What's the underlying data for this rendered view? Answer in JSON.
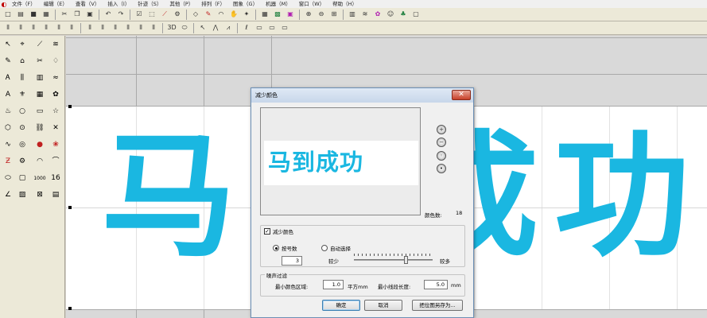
{
  "menu": {
    "items": [
      "文件（F）",
      "编辑（E）",
      "查看（V）",
      "插入（I）",
      "针迹（S）",
      "其他（P）",
      "排列（F）",
      "图象（G）",
      "机器（M）",
      "窗口（W）",
      "帮助（H）"
    ]
  },
  "toolbar1": {
    "icons": [
      "new-file-icon",
      "open-folder-icon",
      "save-icon",
      "print-icon",
      "cut-icon",
      "copy-icon",
      "paste-icon",
      "undo-icon",
      "redo-icon",
      "rect-select-icon",
      "node-edit-icon",
      "needle-icon",
      "tool-icon",
      "shape-icon",
      "pen-icon",
      "curve-icon",
      "hand-icon",
      "wand-icon",
      "grid-icon",
      "picture-icon",
      "color-icon",
      "zoom-in-icon",
      "zoom-out-icon",
      "zoom-all-icon",
      "fill-pattern-icon",
      "stitch-icon",
      "flower-icon",
      "people-icon",
      "tree-icon",
      "frame-icon"
    ],
    "glyphs": [
      "□",
      "▤",
      "■",
      "▦",
      "✂",
      "❐",
      "▣",
      "↶",
      "↷",
      "☑",
      "⬚",
      "⟋",
      "⚙",
      "◇",
      "✎",
      "◠",
      "✋",
      "✦",
      "▦",
      "▩",
      "▣",
      "⊕",
      "⊖",
      "⊞",
      "▥",
      "≋",
      "✿",
      "☺",
      "♣",
      "▢"
    ]
  },
  "toolbar2": {
    "icons": [
      "align-left-icon",
      "align-right-icon",
      "align-top-icon",
      "align-bottom-icon",
      "distribute-h-icon",
      "distribute-v-icon",
      "space-h-icon",
      "space-v-icon",
      "group-icon",
      "ungroup-icon",
      "rotate-icon",
      "mirror-icon",
      "3d-view-icon",
      "rounded-shape-icon",
      "cursor-arrow-icon",
      "stitch-path-icon",
      "running-stitch-icon",
      "satin-stitch-icon",
      "fill-stitch-icon",
      "motif-icon",
      "border-icon"
    ],
    "glyphs": [
      "⫴",
      "⫴",
      "⫴",
      "⫴",
      "⫴",
      "⫴",
      "⫴",
      "⫴",
      "⫴",
      "⫴",
      "⫴",
      "⫴",
      "3D",
      "⬭",
      "↖",
      "⋀",
      "⩘",
      "ℓ",
      "▭",
      "▭",
      "▭"
    ]
  },
  "palette": {
    "icons": [
      "arrow-select-icon",
      "node-select-icon",
      "line-tool-icon",
      "zigzag-icon",
      "pen-tool-icon",
      "house-shape-icon",
      "scissors-icon",
      "satin-icon",
      "stitch-a-icon",
      "column-icon",
      "fill-icon",
      "zigzag-fill-icon",
      "text-a-icon",
      "ribbon-icon",
      "tatami-icon",
      "applique-icon",
      "monogram-icon",
      "circle-tool-icon",
      "rectangle-tool-icon",
      "star-tool-icon",
      "polygon-tool-icon",
      "sequin-icon",
      "chain-icon",
      "cross-stitch-icon",
      "wave-icon",
      "spiral-icon",
      "bead-icon",
      "rose-icon",
      "letter-n-icon",
      "gear-wheel-icon",
      "curve-tool-icon",
      "arc-tool-icon",
      "ellipse-tool-icon",
      "box-tool-icon",
      "abc-text-icon",
      "number-text-icon",
      "angle-icon",
      "flat-fill-icon",
      "contour-icon",
      "tablet-icon"
    ],
    "glyphs": [
      "↖",
      "⌖",
      "⟋",
      "≋",
      "✎",
      "⌂",
      "✂",
      "♢",
      "Ꭺ",
      "⫼",
      "▥",
      "≈",
      "A",
      "⚜",
      "▦",
      "✿",
      "♨",
      "○",
      "▭",
      "☆",
      "⬡",
      "⊙",
      "⛓",
      "✕",
      "∿",
      "◎",
      "●",
      "❀",
      "Ƶ",
      "⚙",
      "◠",
      "⌒",
      "⬭",
      "▢",
      "1000",
      "16",
      "∠",
      "▨",
      "⊠",
      "▤"
    ]
  },
  "canvas": {
    "big_text": "马到成功"
  },
  "dialog": {
    "title": "减少颜色",
    "close_glyph": "✕",
    "preview_text": "马到成功",
    "colors_label": "颜色数:",
    "colors_value": "18",
    "reduce_check_label": "减少颜色",
    "reduce_checked": true,
    "radio_by_count": "按号数",
    "radio_auto": "自动选择",
    "count_value": "3",
    "fewer_label": "较少",
    "more_label": "较多",
    "slider_position": 0.66,
    "noise_label": "噪声过滤",
    "min_area_label": "最小颜色区域:",
    "min_area_value": "1.0",
    "area_unit": "平方mm",
    "min_seg_label": "最小线段长度:",
    "min_seg_value": "5.0",
    "seg_unit": "mm",
    "ok_label": "确定",
    "cancel_label": "取消",
    "save_label": "把位图另存为..."
  },
  "colors": {
    "accent_cyan": "#1ab7e1",
    "close_red": "#c7412a"
  }
}
